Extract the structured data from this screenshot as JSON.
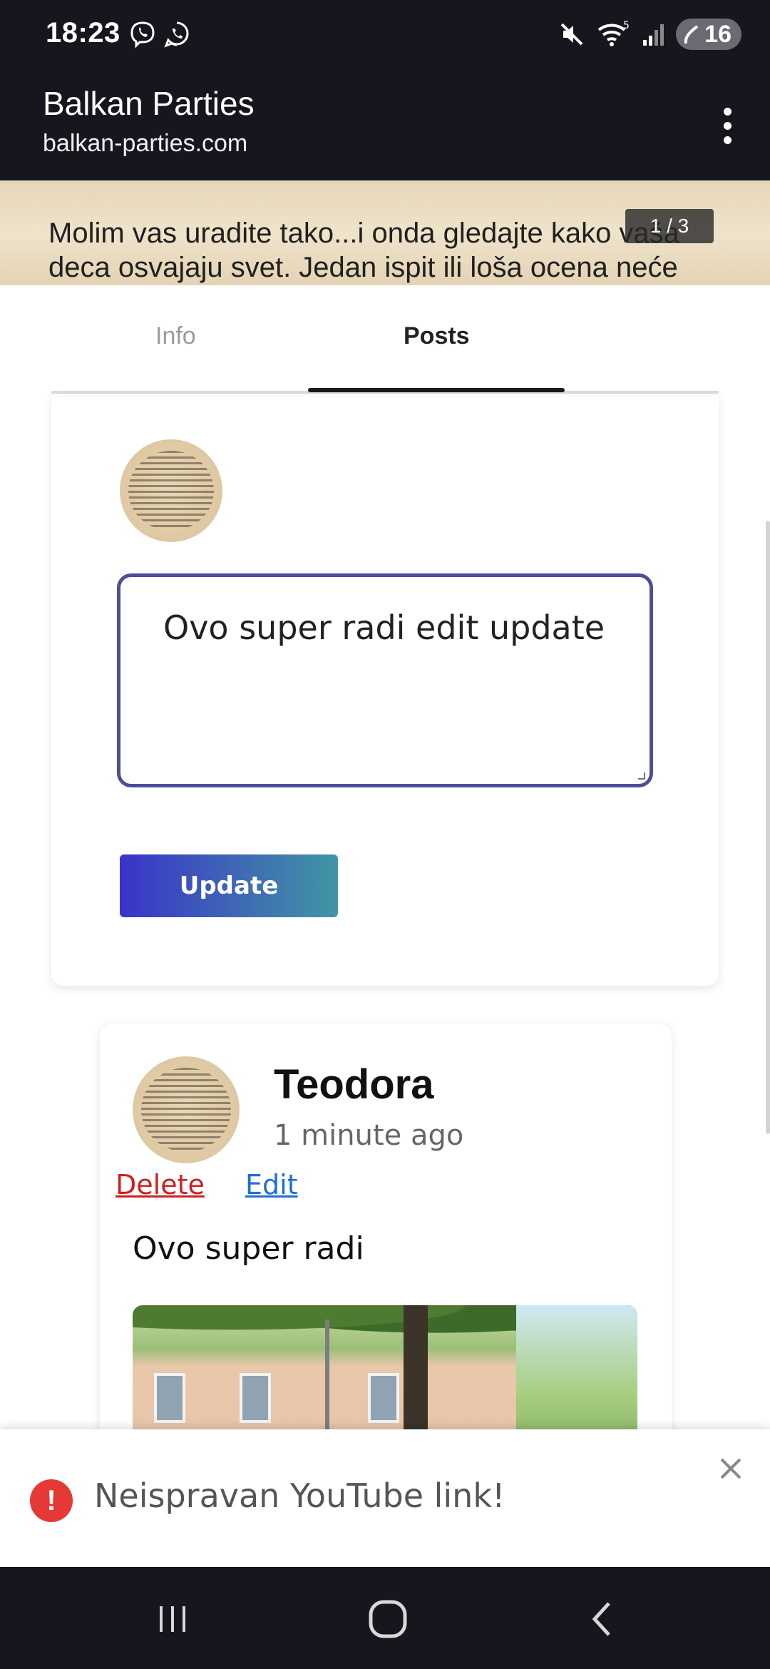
{
  "status_bar": {
    "time": "18:23",
    "left_icons": [
      "viber-icon",
      "whatsapp-icon"
    ],
    "right_icons": [
      "mute-icon",
      "wifi-icon",
      "signal-icon"
    ],
    "wifi_label": "5",
    "battery": "16"
  },
  "app_bar": {
    "title": "Balkan Parties",
    "url": "balkan-parties.com",
    "menu_icon": "more-vert-icon"
  },
  "banner": {
    "text_line1": "Molim vas uradite tako...i onda gledajte kako vaša",
    "text_line2": "deca osvajaju svet. Jedan ispit ili loša ocena neće",
    "counter": "1 / 3"
  },
  "tabs": [
    {
      "label": "Info",
      "active": false
    },
    {
      "label": "Posts",
      "active": true
    }
  ],
  "edit_form": {
    "textarea_value": "Ovo super radi edit update",
    "submit_label": "Update"
  },
  "post": {
    "author": "Teodora",
    "time": "1 minute ago",
    "delete_label": "Delete",
    "edit_label": "Edit",
    "text": "Ovo super radi"
  },
  "toast": {
    "message": "Neispravan YouTube link!",
    "icon": "error-icon",
    "close_icon": "close-icon"
  },
  "nav_bar": {
    "icons": [
      "recent-apps-icon",
      "home-icon",
      "back-icon"
    ]
  },
  "colors": {
    "bar_bg": "#16161f",
    "delete": "#d11f1f",
    "edit": "#1f6fd1",
    "button_start": "#3a33c8",
    "button_end": "#4196a4",
    "error": "#e53935"
  }
}
